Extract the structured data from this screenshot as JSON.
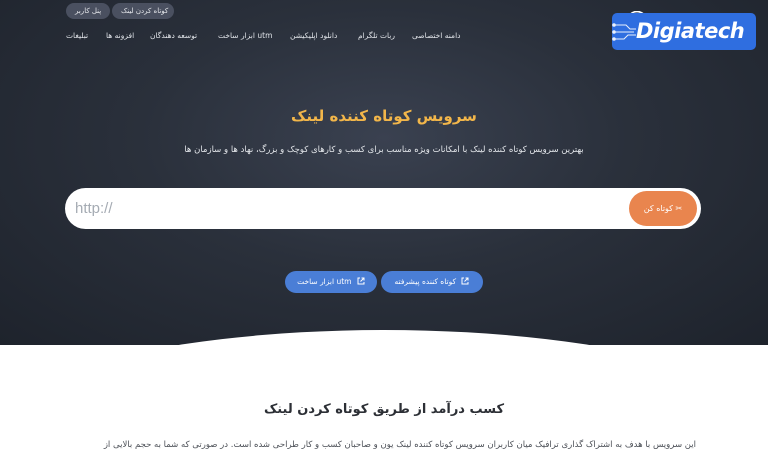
{
  "topbar": {
    "user_panel": "پنل کاربر",
    "shorten_link": "کوتاه کردن لینک"
  },
  "nav": {
    "items": [
      "تبلیغات",
      "افزونه ها",
      "توسعه دهندگان",
      "ابزار ساخت utm",
      "دانلود اپلیکیشن",
      "ربات تلگرام",
      "دامنه اختصاصی"
    ]
  },
  "logo": {
    "text": "Digiatech"
  },
  "hero": {
    "title": "سرویس کوتاه کننده لینک",
    "subtitle": "بهترین سرویس کوتاه کننده لینک با امکانات ویژه مناسب برای کسب و کارهای کوچک و بزرگ، نهاد ها و سازمان ها",
    "url_placeholder": "http://",
    "shorten_button": "کوتاه کن",
    "utm_button": "ابزار ساخت utm",
    "advanced_button": "کوتاه کننده پیشرفته"
  },
  "section": {
    "title": "کسب درآمد از طریق کوتاه کردن لینک",
    "body": "این سرویس با هدف به اشتراک گذاری ترافیک میان کاربران سرویس کوتاه کننده لینک یون و صاحبان کسب و کار طراحی شده است. در صورتی که شما به حجم بالایی از"
  },
  "colors": {
    "accent_orange": "#e9854e",
    "title_gold": "#f2b64a",
    "pill_blue": "#4a7ed6",
    "logo_blue": "#2f6ee0"
  }
}
